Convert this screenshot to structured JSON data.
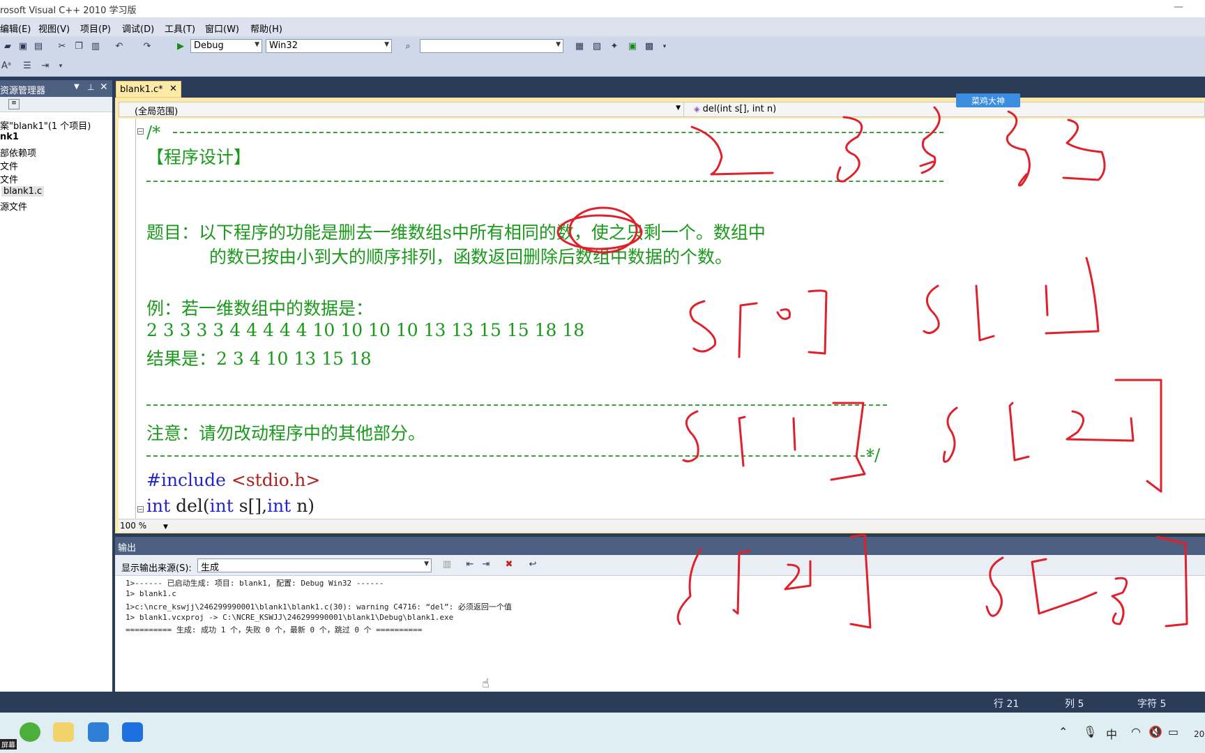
{
  "window": {
    "title": "rosoft Visual C++ 2010 学习版"
  },
  "menu": [
    "编辑(E)",
    "视图(V)",
    "项目(P)",
    "调试(D)",
    "工具(T)",
    "窗口(W)",
    "帮助(H)"
  ],
  "toolbar": {
    "config": "Debug",
    "platform": "Win32",
    "find_value": ""
  },
  "sidebar": {
    "title": "资源管理器",
    "items": [
      "案\"blank1\"(1 个项目)",
      "nk1",
      "部依赖项",
      "文件",
      "文件",
      "blank1.c",
      "源文件"
    ]
  },
  "editor": {
    "tab_label": "blank1.c*",
    "scope": "(全局范围)",
    "function": "del(int s[], int n)",
    "zoom": "100 %",
    "lines": {
      "comment_open": "/*",
      "heading": "【程序设计】",
      "problem_1": "题目：以下程序的功能是删去一维数组s中所有相同的数，使之只剩一个。数组中",
      "problem_2": "的数已按由小到大的顺序排列，函数返回删除后数组中数据的个数。",
      "example_label": "例：若一维数组中的数据是：",
      "example_data": "2  3  3  3  3  4  4  4  4  4  10  10  10  10  13  13  15  15  18  18",
      "result": "结果是：2  3  4  10  13  15  18",
      "note": "注意：请勿改动程序中的其他部分。",
      "comment_close": "*/",
      "include_kw": "#include",
      "include_file": "<stdio.h>",
      "func_kw1": "int",
      "func_name": "del(",
      "func_kw2": "int",
      "func_param1": "s[],",
      "func_kw3": "int",
      "func_param2": "n)"
    }
  },
  "output": {
    "title": "输出",
    "source_label": "显示输出来源(S):",
    "source_value": "生成",
    "lines": [
      "1>------ 已启动生成: 项目: blank1, 配置: Debug Win32 ------",
      "1>  blank1.c",
      "1>c:\\ncre_kswjj\\246299990001\\blank1\\blank1.c(30): warning C4716: “del”: 必须返回一个值",
      "1>  blank1.vcxproj -> C:\\NCRE_KSWJJ\\246299990001\\blank1\\Debug\\blank1.exe",
      "========== 生成: 成功 1 个，失败 0 个，最新 0 个，跳过 0 个 =========="
    ]
  },
  "status": {
    "line": "行 21",
    "col": "列 5",
    "char": "字符 5"
  },
  "watermark": "菜鸡大神",
  "taskbar": {
    "tray_ime": "中",
    "clock_partial": "20",
    "left_label": "屏幕"
  },
  "colors": {
    "comment_green": "#1a9a1a",
    "keyword_blue": "#2626c4",
    "include_red": "#b02020",
    "annotation_red": "#e0202a",
    "tab_yellow": "#fde9a8",
    "chrome_navy": "#2b3c59"
  }
}
